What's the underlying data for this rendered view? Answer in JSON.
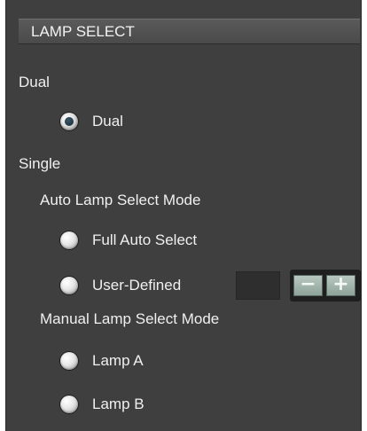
{
  "header": {
    "title": "LAMP SELECT"
  },
  "sections": {
    "dual_label": "Dual",
    "single_label": "Single",
    "auto_mode_label": "Auto Lamp Select Mode",
    "manual_mode_label": "Manual Lamp Select Mode"
  },
  "options": {
    "dual": {
      "label": "Dual",
      "selected": true
    },
    "full_auto": {
      "label": "Full Auto Select",
      "selected": false
    },
    "user_defined": {
      "label": "User-Defined",
      "selected": false
    },
    "lamp_a": {
      "label": "Lamp A",
      "selected": false
    },
    "lamp_b": {
      "label": "Lamp B",
      "selected": false
    }
  },
  "stepper": {
    "minus_label": "−",
    "plus_label": "+",
    "value": ""
  },
  "colors": {
    "panel_bg": "#3f3f3f",
    "text": "#f0f0f0",
    "stepper_btn": "#a8bab2"
  }
}
